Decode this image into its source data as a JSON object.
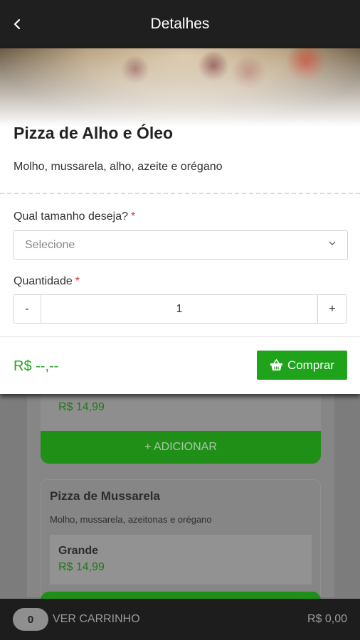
{
  "header": {
    "title": "Detalhes",
    "back_icon": "chevron-left-icon"
  },
  "product": {
    "name": "Pizza de Alho e Óleo",
    "description": "Molho, mussarela, alho, azeite e orégano"
  },
  "form": {
    "size_label": "Qual tamanho deseja?",
    "required_mark": "*",
    "size_placeholder": "Selecione",
    "quantity_label": "Quantidade",
    "quantity_minus": "-",
    "quantity_value": "1",
    "quantity_plus": "+"
  },
  "footer": {
    "total": "R$ --,--",
    "buy_label": "Comprar",
    "buy_icon": "basket-icon"
  },
  "background_list": {
    "item1_price": "R$ 14,99",
    "add_label": "+ ADICIONAR",
    "item2_name": "Pizza de Mussarela",
    "item2_desc": "Molho, mussarela, azeitonas e orégano",
    "item2_size": "Grande",
    "item2_price": "R$ 14,99"
  },
  "cart_bar": {
    "count": "0",
    "label": "VER CARRINHO",
    "total": "R$ 0,00"
  },
  "colors": {
    "accent": "#1ea31a",
    "header": "#1f1f1f",
    "price_green": "#23a81b"
  }
}
